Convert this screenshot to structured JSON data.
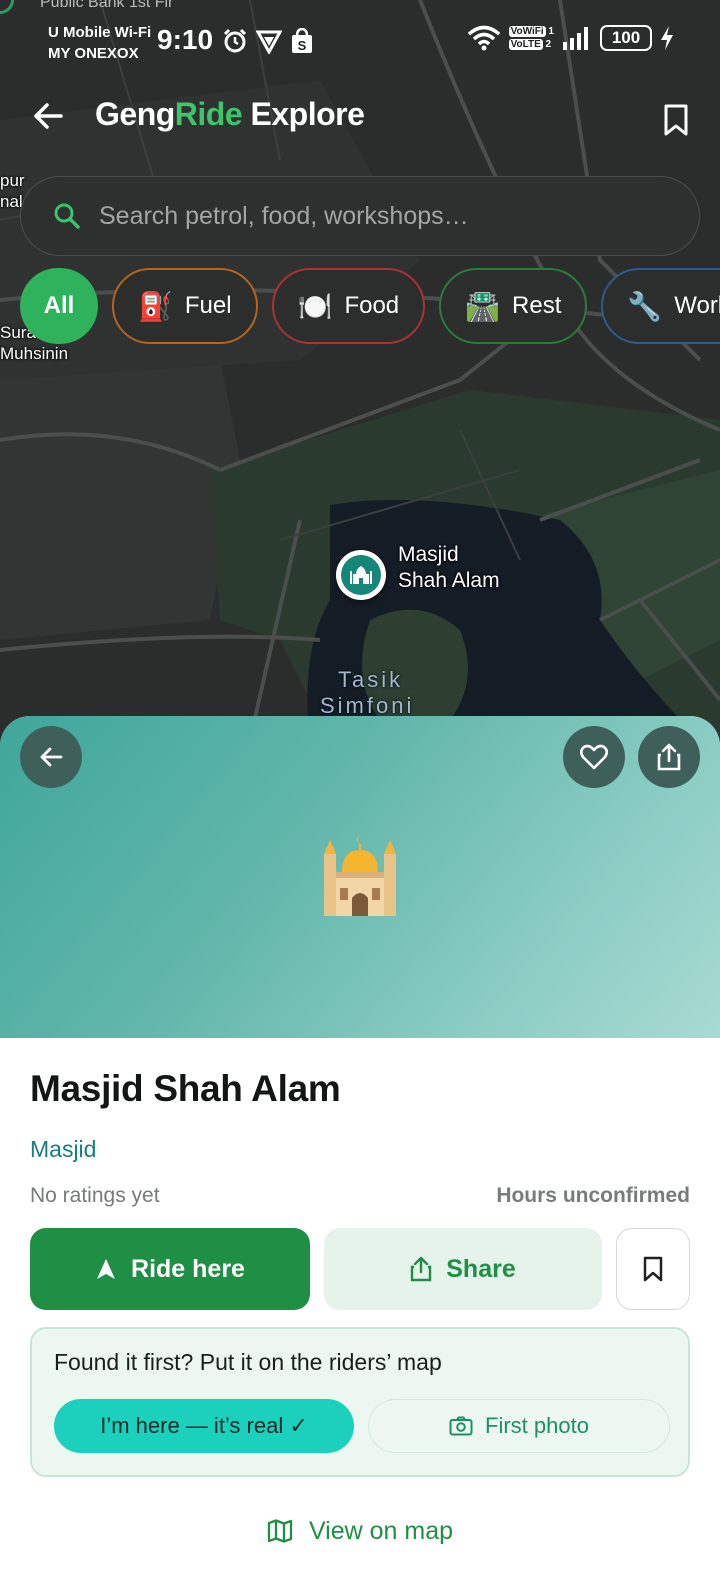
{
  "status_bar": {
    "notification_peek": "Public Bank 1st Flr",
    "carrier_line1": "U Mobile Wi-Fi",
    "carrier_line2": "MY ONEXOX",
    "time": "9:10",
    "vowifi": "VoWiFi",
    "volte": "VoLTE",
    "battery": "100"
  },
  "header": {
    "brand_part1": "Geng",
    "brand_part2": "Ride",
    "brand_part3": " Explore"
  },
  "search": {
    "placeholder": "Search petrol, food, workshops…"
  },
  "chips": [
    {
      "label": "All",
      "selected": true
    },
    {
      "label": "Fuel",
      "icon": "⛽",
      "color": "#b5641f"
    },
    {
      "label": "Food",
      "icon": "🍽️",
      "color": "#a83236"
    },
    {
      "label": "Rest",
      "icon": "🛣️",
      "color": "#2c7a3c"
    },
    {
      "label": "Workshop",
      "icon": "🔧",
      "color": "#2f5b8c"
    }
  ],
  "map": {
    "label_left_top": "pur\nnal",
    "label_left": "Sura\nMuhsinin",
    "poi_name_line1": "Masjid",
    "poi_name_line2": "Shah Alam",
    "lake_line1": "Tasik",
    "lake_line2": "Simfoni"
  },
  "place": {
    "hero_icon": "mosque-icon",
    "name": "Masjid Shah Alam",
    "category": "Masjid",
    "ratings": "No ratings yet",
    "hours": "Hours unconfirmed"
  },
  "actions": {
    "ride_label": "Ride here",
    "share_label": "Share"
  },
  "contribute": {
    "title": "Found it first? Put it on the riders’ map",
    "confirm_label": "I’m here — it’s real ✓",
    "photo_label": "First photo"
  },
  "footer": {
    "view_map_label": "View on map"
  },
  "colors": {
    "brand_green": "#3ec46a",
    "primary_green": "#1f8f45",
    "teal": "#148079",
    "confirm_teal": "#1bd1bd"
  }
}
